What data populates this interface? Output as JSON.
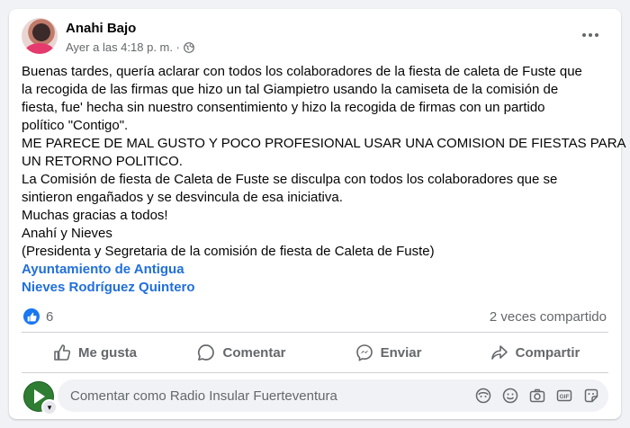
{
  "post": {
    "author": "Anahi Bajo",
    "timestamp": "Ayer a las 4:18 p. m. ·",
    "audience_icon": "globe-icon",
    "text_lines": [
      "Buenas tardes, quería aclarar con todos los colaboradores de la fiesta de caleta de Fuste que",
      "la recogida de las firmas que hizo un tal Giampietro usando la camiseta de la comisión de",
      "fiesta, fue' hecha sin nuestro consentimiento y hizo la recogida de firmas con un partido",
      "político \"Contigo\".",
      "ME PARECE DE MAL GUSTO Y POCO PROFESIONAL USAR UNA COMISION DE FIESTAS PARA",
      "UN RETORNO POLITICO.",
      "La Comisión de fiesta de Caleta de Fuste se disculpa con todos los colaboradores que se",
      "sintieron engañados y se desvincula de esa iniciativa.",
      "Muchas gracias a todos!",
      "Anahí y Nieves",
      "(Presidenta y Segretaria de la comisión de fiesta de Caleta de Fuste)"
    ],
    "tags": [
      "Ayuntamiento de Antigua",
      "Nieves Rodríguez Quintero"
    ],
    "like_count": "6",
    "shares": "2 veces compartido"
  },
  "actions": {
    "like": "Me gusta",
    "comment": "Comentar",
    "send": "Enviar",
    "share": "Compartir"
  },
  "comment_box": {
    "placeholder": "Comentar como Radio Insular Fuerteventura"
  },
  "colors": {
    "link": "#216fdb",
    "like_blue": "#1877f2",
    "muted": "#65676b"
  }
}
